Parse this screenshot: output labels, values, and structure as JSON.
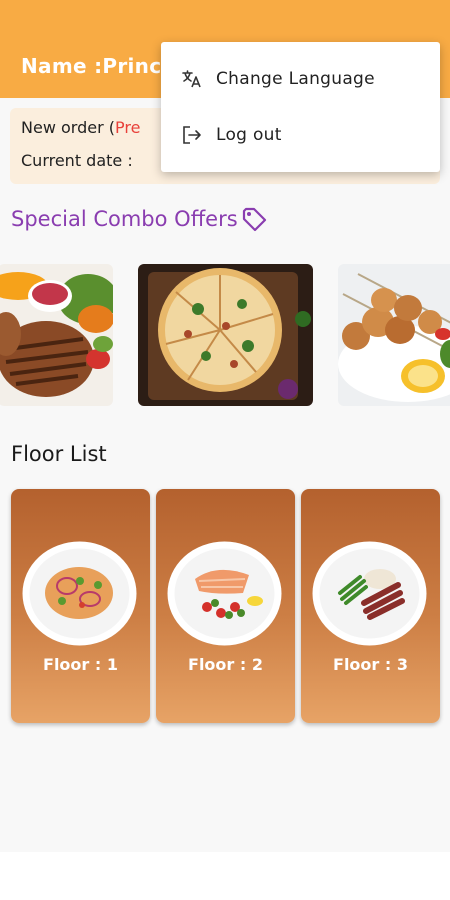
{
  "header": {
    "title": "Name :Princ",
    "background_color": "#f8ab44"
  },
  "info_card": {
    "new_order_label": "New order (",
    "new_order_value": "Pre",
    "current_date_label": "Current date : "
  },
  "offers": {
    "title": "Special Combo Offers",
    "icon": "tag-icon",
    "accent_color": "#8a3db0",
    "items": [
      {
        "name": "grilled-patties-platter"
      },
      {
        "name": "pizza"
      },
      {
        "name": "chicken-skewers"
      }
    ]
  },
  "floors": {
    "title": "Floor List",
    "items": [
      {
        "label": "Floor : 1"
      },
      {
        "label": "Floor : 2"
      },
      {
        "label": "Floor : 3"
      }
    ]
  },
  "menu": {
    "items": [
      {
        "label": "Change Language",
        "icon": "translate-icon"
      },
      {
        "label": "Log out",
        "icon": "logout-icon"
      }
    ]
  }
}
